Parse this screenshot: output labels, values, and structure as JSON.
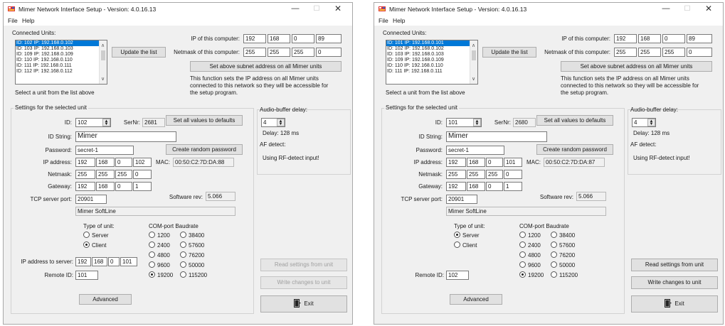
{
  "windows": [
    {
      "title": "Mimer Network Interface Setup - Version: 4.0.16.13",
      "menu": [
        "File",
        "Help"
      ],
      "connected_label": "Connected Units:",
      "units": [
        "ID: 102 IP: 192.168.0.102",
        "ID: 103 IP: 192.168.0.103",
        "ID: 109 IP: 192.168.0.109",
        "ID: 110 IP: 192.168.0.110",
        "ID: 111 IP: 192.168.0.111",
        "ID: 112 IP: 192.168.0.112"
      ],
      "selected_unit_index": 0,
      "update_list": "Update the list",
      "select_hint": "Select a unit from the list above",
      "ip_label": "IP of this computer:",
      "ip": [
        "192",
        "168",
        "0",
        "89"
      ],
      "netmask_label": "Netmask of this computer:",
      "netmask": [
        "255",
        "255",
        "255",
        "0"
      ],
      "subnet_button": "Set above subnet address on all Mimer units",
      "info_text": [
        "This function sets the IP address on all Mimer units",
        "connected to this network so they will be accessible for",
        "the setup program."
      ],
      "settings_label": "Settings for the selected unit",
      "id_label": "ID:",
      "id_value": "102",
      "sernr_label": "SerNr:",
      "sernr_value": "2681",
      "defaults_button": "Set all values to defaults",
      "idstring_label": "ID String:",
      "idstring_value": "Mimer",
      "password_label": "Password:",
      "password_value": "secret-1",
      "random_pw_button": "Create random password",
      "ipaddr_label": "IP address:",
      "ipaddr": [
        "192",
        "168",
        "0",
        "102"
      ],
      "mac_label": "MAC:",
      "mac_value": "00:50:C2:7D:DA:88",
      "netmask2_label": "Netmask:",
      "netmask2": [
        "255",
        "255",
        "255",
        "0"
      ],
      "gateway_label": "Gateway:",
      "gateway": [
        "192",
        "168",
        "0",
        "1"
      ],
      "tcp_label": "TCP server port:",
      "tcp_value": "20901",
      "swrev_label": "Software rev:",
      "swrev_value": "5.066",
      "softline": "Mimer SoftLine",
      "type_label": "Type of unit:",
      "type_options": [
        "Server",
        "Client"
      ],
      "type_selected": 1,
      "baud_label": "COM-port Baudrate",
      "baud_options": [
        "1200",
        "38400",
        "2400",
        "57600",
        "4800",
        "76200",
        "9600",
        "50000",
        "19200",
        "115200"
      ],
      "baud_selected": "19200",
      "ip_server_label": "IP address to server:",
      "ip_server": [
        "192",
        "168",
        "0",
        "101"
      ],
      "remote_label": "Remote ID:",
      "remote_value": "101",
      "advanced_button": "Advanced",
      "audio_label": "Audio-buffer delay:",
      "audio_value": "4",
      "delay_text": "Delay: 128 ms",
      "af_label": "AF detect:",
      "af_text": "Using RF-detect input!",
      "read_button": "Read settings from unit",
      "write_button": "Write changes to unit",
      "actions_enabled": false,
      "exit_button": "Exit"
    },
    {
      "title": "Mimer Network Interface Setup - Version: 4.0.16.13",
      "menu": [
        "File",
        "Help"
      ],
      "connected_label": "Connected Units:",
      "units": [
        "ID: 101 IP: 192.168.0.101",
        "ID: 102 IP: 192.168.0.102",
        "ID: 103 IP: 192.168.0.103",
        "ID: 109 IP: 192.168.0.109",
        "ID: 110 IP: 192.168.0.110",
        "ID: 111 IP: 192.168.0.111"
      ],
      "selected_unit_index": 0,
      "update_list": "Update the list",
      "select_hint": "Select a unit from the list above",
      "ip_label": "IP of this computer:",
      "ip": [
        "192",
        "168",
        "0",
        "89"
      ],
      "netmask_label": "Netmask of this computer:",
      "netmask": [
        "255",
        "255",
        "255",
        "0"
      ],
      "subnet_button": "Set above subnet address on all Mimer units",
      "info_text": [
        "This function sets the IP address on all Mimer units",
        "connected to this network so they will be accessible for",
        "the setup program."
      ],
      "settings_label": "Settings for the selected unit",
      "id_label": "ID:",
      "id_value": "101",
      "sernr_label": "SerNr:",
      "sernr_value": "2680",
      "defaults_button": "Set all values to defaults",
      "idstring_label": "ID String:",
      "idstring_value": "Mimer",
      "password_label": "Password:",
      "password_value": "secret-1",
      "random_pw_button": "Create random password",
      "ipaddr_label": "IP address:",
      "ipaddr": [
        "192",
        "168",
        "0",
        "101"
      ],
      "mac_label": "MAC:",
      "mac_value": "00:50:C2:7D:DA:87",
      "netmask2_label": "Netmask:",
      "netmask2": [
        "255",
        "255",
        "255",
        "0"
      ],
      "gateway_label": "Gateway:",
      "gateway": [
        "192",
        "168",
        "0",
        "1"
      ],
      "tcp_label": "TCP server port:",
      "tcp_value": "20901",
      "swrev_label": "Software rev:",
      "swrev_value": "5.066",
      "softline": "Mimer SoftLine",
      "type_label": "Type of unit:",
      "type_options": [
        "Server",
        "Client"
      ],
      "type_selected": 0,
      "baud_label": "COM-port Baudrate",
      "baud_options": [
        "1200",
        "38400",
        "2400",
        "57600",
        "4800",
        "76200",
        "9600",
        "50000",
        "19200",
        "115200"
      ],
      "baud_selected": "19200",
      "ip_server_label": "",
      "ip_server": [],
      "remote_label": "Remote ID:",
      "remote_value": "102",
      "advanced_button": "Advanced",
      "audio_label": "Audio-buffer delay:",
      "audio_value": "4",
      "delay_text": "Delay: 128 ms",
      "af_label": "AF detect:",
      "af_text": "Using RF-detect input!",
      "read_button": "Read settings from unit",
      "write_button": "Write changes to unit",
      "actions_enabled": true,
      "exit_button": "Exit"
    }
  ],
  "colors": {
    "window_bg": "#f0f0f0",
    "selection": "#0078d7",
    "button_face": "#e1e1e1",
    "disabled_text": "#a0a0a0"
  }
}
